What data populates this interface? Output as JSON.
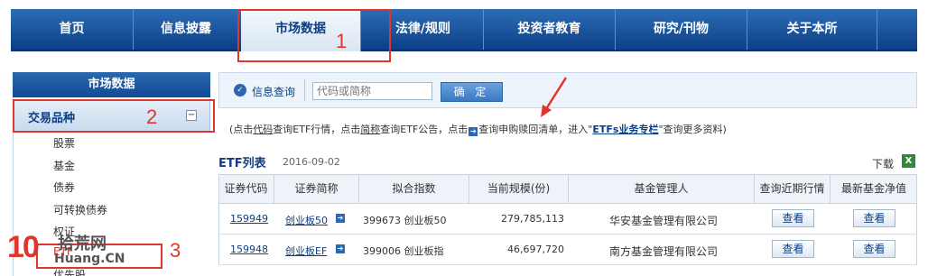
{
  "nav": {
    "items": [
      "首页",
      "信息披露",
      "市场数据",
      "法律/规则",
      "投资者教育",
      "研究/刊物",
      "关于本所"
    ],
    "active": "市场数据"
  },
  "annotations": [
    "1",
    "2",
    "3"
  ],
  "sidebar": {
    "title": "市场数据",
    "category": "交易品种",
    "toggle": "−",
    "items": [
      "股票",
      "基金",
      "债券",
      "可转换债券",
      "权证",
      "ETF",
      "优先股"
    ]
  },
  "search": {
    "icon": "check-circle-icon",
    "label": "信息查询",
    "placeholder": "代码或简称",
    "button": "确 定"
  },
  "notice": {
    "p1": "(点击",
    "p2": "代码",
    "p3": "查询ETF行情，点击",
    "p4": "简称",
    "p5": "查询ETF公告，点击",
    "p6": "查询申购赎回清单，进入\"",
    "p7": "ETFs业务专栏",
    "p8": "\"查询更多资料)"
  },
  "etf": {
    "title": "ETF列表",
    "date": "2016-09-02",
    "download": "下载",
    "download_icon": "excel-icon"
  },
  "table": {
    "headers": [
      "证券代码",
      "证券简称",
      "拟合指数",
      "当前规模(份)",
      "基金管理人",
      "查询近期行情",
      "最新基金净值"
    ],
    "rows": [
      {
        "code": "159949",
        "name": "创业板50",
        "index": "399673 创业板50",
        "scale": "279,785,113",
        "manager": "华安基金管理有限公司",
        "btn1": "查看",
        "btn2": "查看"
      },
      {
        "code": "159948",
        "name": "创业板EF",
        "index": "399006 创业板指",
        "scale": "46,697,720",
        "manager": "南方基金管理有限公司",
        "btn1": "查看",
        "btn2": "查看"
      }
    ]
  },
  "watermark": {
    "site": "拾荒网",
    "domain": "Huang.CN",
    "brand": "10"
  },
  "colors": {
    "nav_blue": "#0c3f86",
    "annotation_red": "#e0352d"
  }
}
